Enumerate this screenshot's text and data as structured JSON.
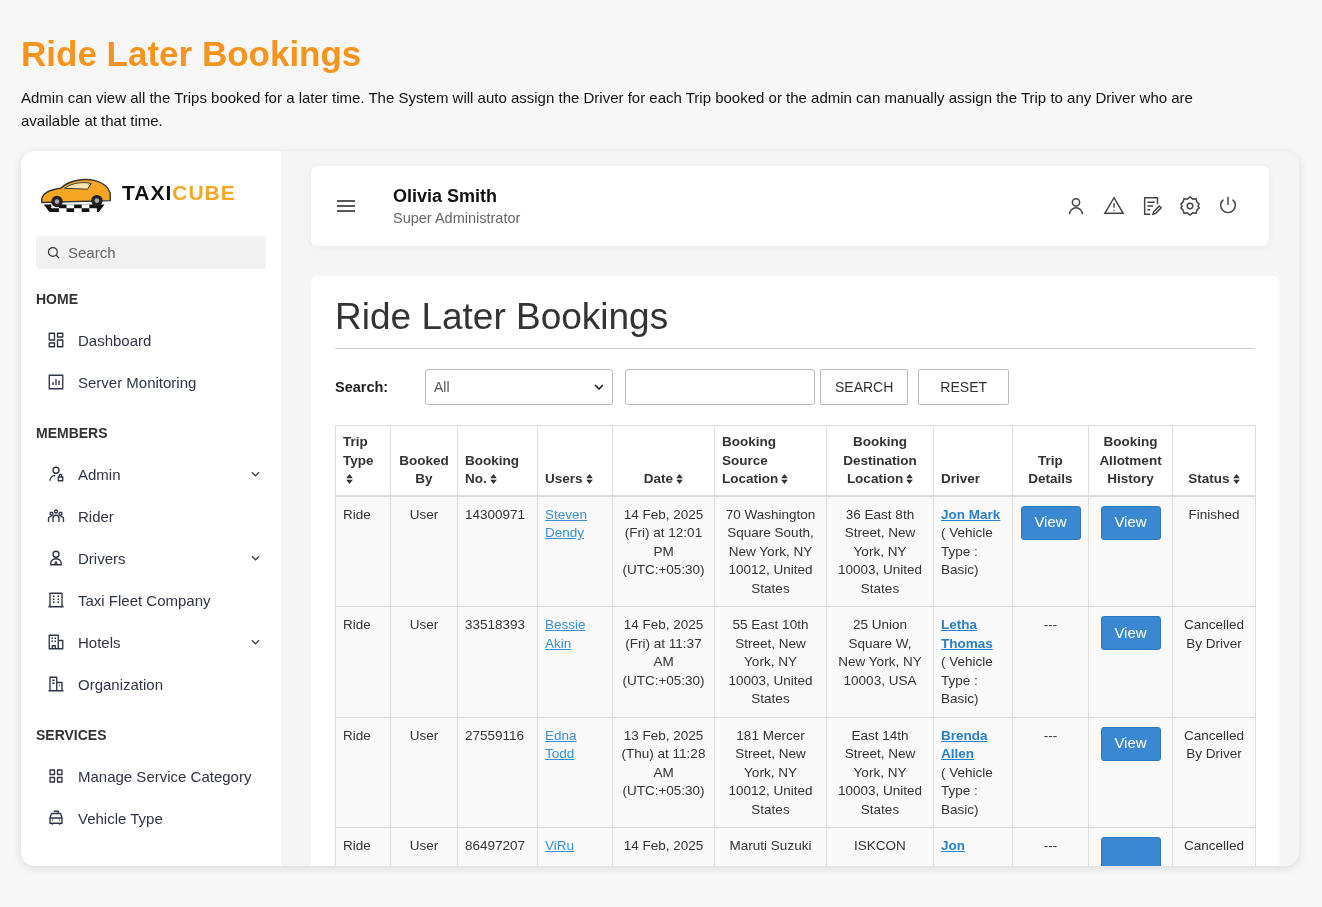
{
  "page": {
    "title": "Ride Later Bookings",
    "description": "Admin can view all the Trips booked for a later time. The System will auto assign the Driver for each Trip booked or the admin can manually assign the Trip to any Driver who are available at that time."
  },
  "brand": {
    "first": "TAXI",
    "second": "CUBE"
  },
  "sidebar": {
    "search": {
      "placeholder": "Search"
    },
    "sections": [
      {
        "title": "HOME",
        "items": [
          {
            "label": "Dashboard",
            "expandable": false
          },
          {
            "label": "Server Monitoring",
            "expandable": false
          }
        ]
      },
      {
        "title": "MEMBERS",
        "items": [
          {
            "label": "Admin",
            "expandable": true
          },
          {
            "label": "Rider",
            "expandable": false
          },
          {
            "label": "Drivers",
            "expandable": true
          },
          {
            "label": "Taxi Fleet Company",
            "expandable": false
          },
          {
            "label": "Hotels",
            "expandable": true
          },
          {
            "label": "Organization",
            "expandable": false
          }
        ]
      },
      {
        "title": "SERVICES",
        "items": [
          {
            "label": "Manage Service Category",
            "expandable": false
          },
          {
            "label": "Vehicle Type",
            "expandable": false
          }
        ]
      }
    ]
  },
  "header": {
    "name": "Olivia Smith",
    "role": "Super Administrator"
  },
  "content": {
    "title": "Ride Later Bookings",
    "filter": {
      "label": "Search:",
      "select": "All",
      "buttons": [
        "SEARCH",
        "RESET"
      ]
    },
    "table": {
      "columns": [
        {
          "label": "Trip Type",
          "sortable": true
        },
        {
          "label": "Booked By",
          "sortable": false
        },
        {
          "label": "Booking No.",
          "sortable": true
        },
        {
          "label": "Users",
          "sortable": true
        },
        {
          "label": "Date",
          "sortable": true
        },
        {
          "label": "Booking Source Location",
          "sortable": true
        },
        {
          "label": "Booking Destination Location",
          "sortable": true
        },
        {
          "label": "Driver",
          "sortable": false
        },
        {
          "label": "Trip Details",
          "sortable": false
        },
        {
          "label": "Booking Allotment History",
          "sortable": false
        },
        {
          "label": "Status",
          "sortable": true
        }
      ],
      "rows": [
        {
          "trip_type": "Ride",
          "booked_by": "User",
          "booking_no": "14300971",
          "user": "Steven Dendy",
          "date": "14 Feb, 2025 (Fri) at 12:01 PM (UTC:+05:30)",
          "source": "70 Washington Square South, New York, NY 10012, United States",
          "destination": "36 East 8th Street, New York, NY 10003, United States",
          "driver": "Jon Mark",
          "vehicle": "( Vehicle Type : Basic)",
          "trip_details": {
            "kind": "button",
            "label": "View"
          },
          "allotment": {
            "kind": "button",
            "label": "View"
          },
          "status": "Finished"
        },
        {
          "trip_type": "Ride",
          "booked_by": "User",
          "booking_no": "33518393",
          "user": "Bessie Akin",
          "date": "14 Feb, 2025 (Fri) at 11:37 AM (UTC:+05:30)",
          "source": "55 East 10th Street, New York, NY 10003, United States",
          "destination": "25 Union Square W, New York, NY 10003, USA",
          "driver": "Letha Thomas",
          "vehicle": "( Vehicle Type : Basic)",
          "trip_details": {
            "kind": "text",
            "label": "---"
          },
          "allotment": {
            "kind": "button",
            "label": "View"
          },
          "status": "Cancelled By Driver"
        },
        {
          "trip_type": "Ride",
          "booked_by": "User",
          "booking_no": "27559116",
          "user": "Edna Todd",
          "date": "13 Feb, 2025 (Thu) at 11:28 AM (UTC:+05:30)",
          "source": "181 Mercer Street, New York, NY 10012, United States",
          "destination": "East 14th Street, New York, NY 10003, United States",
          "driver": "Brenda Allen",
          "vehicle": "( Vehicle Type : Basic)",
          "trip_details": {
            "kind": "text",
            "label": "---"
          },
          "allotment": {
            "kind": "button",
            "label": "View"
          },
          "status": "Cancelled By Driver"
        },
        {
          "trip_type": "Ride",
          "booked_by": "User",
          "booking_no": "86497207",
          "user": "ViRu",
          "date": "14 Feb, 2025",
          "source": "Maruti Suzuki",
          "destination": "ISKCON",
          "driver": "Jon",
          "trip_details": {
            "kind": "text",
            "label": "---"
          },
          "allotment": {
            "kind": "button"
          },
          "status": "Cancelled"
        }
      ]
    }
  }
}
